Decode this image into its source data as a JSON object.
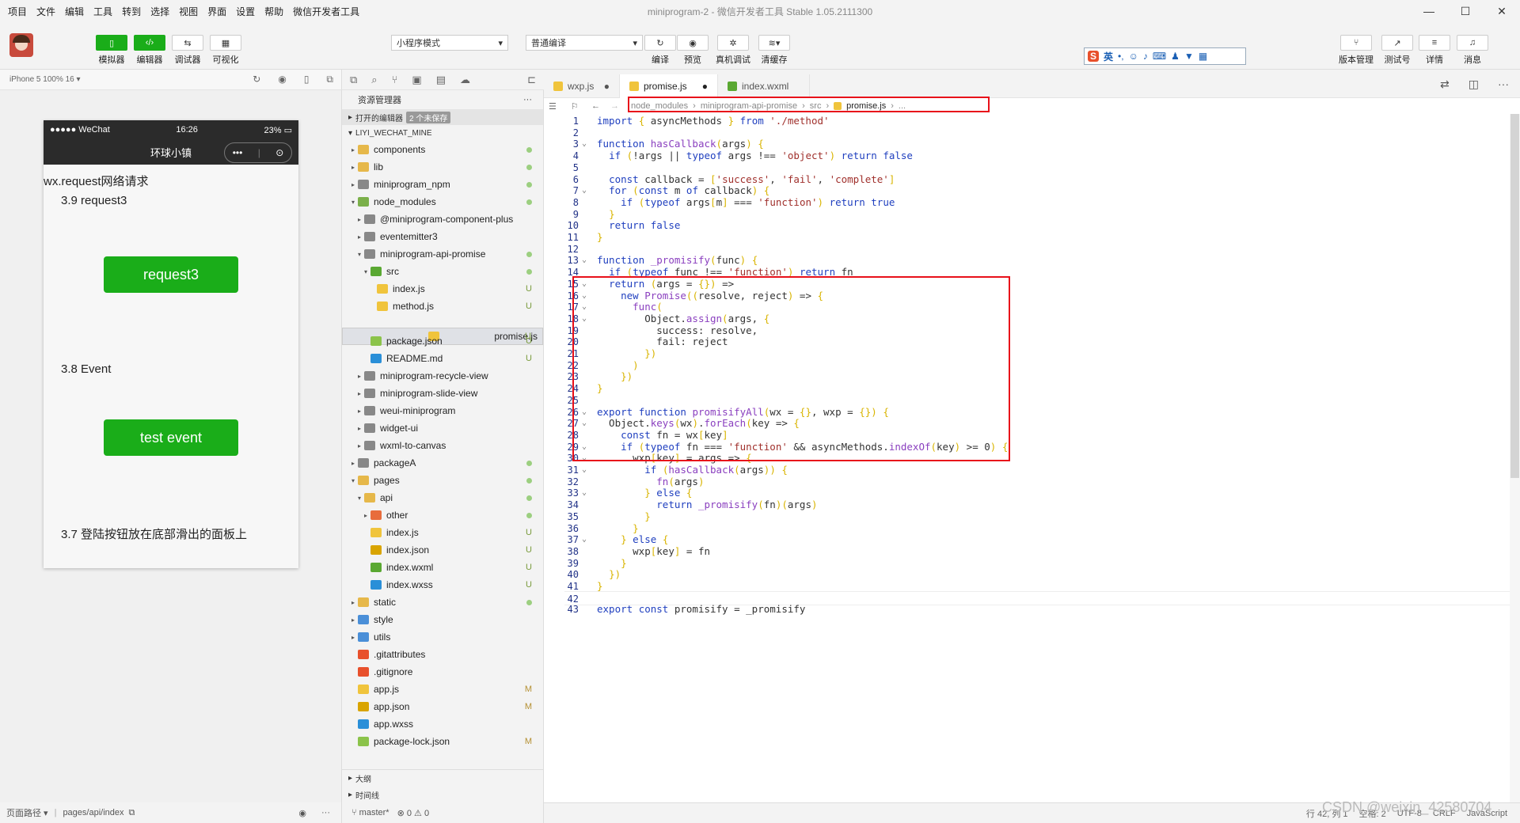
{
  "menubar": {
    "items": [
      "项目",
      "文件",
      "编辑",
      "工具",
      "转到",
      "选择",
      "视图",
      "界面",
      "设置",
      "帮助",
      "微信开发者工具"
    ],
    "title_project": "miniprogram-2",
    "title_rest": " - 微信开发者工具 Stable 1.05.2111300",
    "window_controls": [
      "—",
      "☐",
      "✕"
    ]
  },
  "toolbar": {
    "left": [
      {
        "icon": "phone-icon",
        "label": "模拟器"
      },
      {
        "icon": "code-icon",
        "label": "编辑器"
      },
      {
        "icon": "debug-icon",
        "label": "调试器"
      },
      {
        "icon": "layout-icon",
        "label": "可视化"
      }
    ],
    "mode_select": "小程序模式",
    "compile_select": "普通编译",
    "actions": [
      {
        "icon": "refresh-icon",
        "label": "编译"
      },
      {
        "icon": "eye-icon",
        "label": "预览"
      },
      {
        "icon": "bug-icon",
        "label": "真机调试"
      },
      {
        "icon": "layers-icon",
        "label": "清缓存"
      }
    ],
    "right": [
      {
        "icon": "branch-icon",
        "label": "版本管理"
      },
      {
        "icon": "external-icon",
        "label": "测试号"
      },
      {
        "icon": "menu-icon",
        "label": "详情"
      },
      {
        "icon": "bell-icon",
        "label": "消息"
      }
    ],
    "ime_text": "英"
  },
  "simulator": {
    "device": "iPhone 5 100% 16 ▾",
    "status_left": "●●●●● WeChat",
    "status_time": "16:26",
    "status_battery": "23%",
    "nav_title": "环球小镇",
    "capsule_more": "•••",
    "capsule_close": "⊙",
    "heading": "wx.request网络请求",
    "section1": "3.9 request3",
    "button1": "request3",
    "section2": "3.8 Event",
    "button2": "test event",
    "section3": "3.7 登陆按钮放在底部滑出的面板上",
    "footer_path_label": "页面路径 ▾",
    "footer_path": "pages/api/index"
  },
  "explorer": {
    "title": "资源管理器",
    "more": "···",
    "open_editors": "打开的编辑器",
    "unsaved": "2 个未保存",
    "root": "LIYI_WECHAT_MINE",
    "rows": [
      {
        "label": "components",
        "indent": 1,
        "tw": "▸",
        "color": "#e6b84a",
        "st": "dot"
      },
      {
        "label": "lib",
        "indent": 1,
        "tw": "▸",
        "color": "#e6b84a",
        "st": "dot"
      },
      {
        "label": "miniprogram_npm",
        "indent": 1,
        "tw": "▸",
        "color": "#888",
        "st": "dot"
      },
      {
        "label": "node_modules",
        "indent": 1,
        "tw": "▾",
        "color": "#7bb04a",
        "st": "dot"
      },
      {
        "label": "@miniprogram-component-plus",
        "indent": 2,
        "tw": "▸",
        "color": "#888",
        "st": ""
      },
      {
        "label": "eventemitter3",
        "indent": 2,
        "tw": "▸",
        "color": "#888",
        "st": ""
      },
      {
        "label": "miniprogram-api-promise",
        "indent": 2,
        "tw": "▾",
        "color": "#888",
        "st": "dot"
      },
      {
        "label": "src",
        "indent": 3,
        "tw": "▾",
        "color": "#5aa832",
        "st": "dot"
      },
      {
        "label": "index.js",
        "indent": 4,
        "tw": "",
        "color": "#f0c43c",
        "st": "U"
      },
      {
        "label": "method.js",
        "indent": 4,
        "tw": "",
        "color": "#f0c43c",
        "st": "U"
      },
      {
        "label": "promise.js",
        "indent": 4,
        "tw": "",
        "color": "#f0c43c",
        "st": "U",
        "selected": true
      },
      {
        "label": "package.json",
        "indent": 3,
        "tw": "",
        "color": "#8bc34a",
        "st": "U"
      },
      {
        "label": "README.md",
        "indent": 3,
        "tw": "",
        "color": "#2a8fd8",
        "st": "U"
      },
      {
        "label": "miniprogram-recycle-view",
        "indent": 2,
        "tw": "▸",
        "color": "#888",
        "st": ""
      },
      {
        "label": "miniprogram-slide-view",
        "indent": 2,
        "tw": "▸",
        "color": "#888",
        "st": ""
      },
      {
        "label": "weui-miniprogram",
        "indent": 2,
        "tw": "▸",
        "color": "#888",
        "st": ""
      },
      {
        "label": "widget-ui",
        "indent": 2,
        "tw": "▸",
        "color": "#888",
        "st": ""
      },
      {
        "label": "wxml-to-canvas",
        "indent": 2,
        "tw": "▸",
        "color": "#888",
        "st": ""
      },
      {
        "label": "packageA",
        "indent": 1,
        "tw": "▸",
        "color": "#888",
        "st": "dot"
      },
      {
        "label": "pages",
        "indent": 1,
        "tw": "▾",
        "color": "#e6b84a",
        "st": "dot"
      },
      {
        "label": "api",
        "indent": 2,
        "tw": "▾",
        "color": "#e6b84a",
        "st": "dot"
      },
      {
        "label": "other",
        "indent": 3,
        "tw": "▸",
        "color": "#e86c3c",
        "st": "dot"
      },
      {
        "label": "index.js",
        "indent": 3,
        "tw": "",
        "color": "#f0c43c",
        "st": "U"
      },
      {
        "label": "index.json",
        "indent": 3,
        "tw": "",
        "color": "#d9a400",
        "st": "U"
      },
      {
        "label": "index.wxml",
        "indent": 3,
        "tw": "",
        "color": "#5aa832",
        "st": "U"
      },
      {
        "label": "index.wxss",
        "indent": 3,
        "tw": "",
        "color": "#2a8fd8",
        "st": "U"
      },
      {
        "label": "static",
        "indent": 1,
        "tw": "▸",
        "color": "#e6b84a",
        "st": "dot"
      },
      {
        "label": "style",
        "indent": 1,
        "tw": "▸",
        "color": "#4a8fd8",
        "st": ""
      },
      {
        "label": "utils",
        "indent": 1,
        "tw": "▸",
        "color": "#4a8fd8",
        "st": ""
      },
      {
        "label": ".gitattributes",
        "indent": 1,
        "tw": "",
        "color": "#e8502c",
        "st": ""
      },
      {
        "label": ".gitignore",
        "indent": 1,
        "tw": "",
        "color": "#e8502c",
        "st": ""
      },
      {
        "label": "app.js",
        "indent": 1,
        "tw": "",
        "color": "#f0c43c",
        "st": "M"
      },
      {
        "label": "app.json",
        "indent": 1,
        "tw": "",
        "color": "#d9a400",
        "st": "M"
      },
      {
        "label": "app.wxss",
        "indent": 1,
        "tw": "",
        "color": "#2a8fd8",
        "st": ""
      },
      {
        "label": "package-lock.json",
        "indent": 1,
        "tw": "",
        "color": "#8bc34a",
        "st": "M"
      }
    ],
    "outline": "大纲",
    "timeline": "时间线",
    "branch": "master*",
    "problems": "⊗ 0 ⚠ 0"
  },
  "tabs": [
    {
      "label": "wxp.js",
      "icon": "js",
      "modified": true,
      "active": false
    },
    {
      "label": "promise.js",
      "icon": "js",
      "modified": true,
      "active": true
    },
    {
      "label": "index.wxml",
      "icon": "wxml",
      "modified": false,
      "active": false
    }
  ],
  "breadcrumb": [
    "node_modules",
    "miniprogram-api-promise",
    "src",
    "promise.js",
    "..."
  ],
  "code_lines": [
    "import { asyncMethods } from './method'",
    "",
    "function hasCallback(args) {",
    "  if (!args || typeof args !== 'object') return false",
    "",
    "  const callback = ['success', 'fail', 'complete']",
    "  for (const m of callback) {",
    "    if (typeof args[m] === 'function') return true",
    "  }",
    "  return false",
    "}",
    "",
    "function _promisify(func) {",
    "  if (typeof func !== 'function') return fn",
    "  return (args = {}) =>",
    "    new Promise((resolve, reject) => {",
    "      func(",
    "        Object.assign(args, {",
    "          success: resolve,",
    "          fail: reject",
    "        })",
    "      )",
    "    })",
    "}",
    "",
    "export function promisifyAll(wx = {}, wxp = {}) {",
    "  Object.keys(wx).forEach(key => {",
    "    const fn = wx[key]",
    "    if (typeof fn === 'function' && asyncMethods.indexOf(key) >= 0) {",
    "      wxp[key] = args => {",
    "        if (hasCallback(args)) {",
    "          fn(args)",
    "        } else {",
    "          return _promisify(fn)(args)",
    "        }",
    "      }",
    "    } else {",
    "      wxp[key] = fn",
    "    }",
    "  })",
    "}",
    "",
    "export const promisify = _promisify"
  ],
  "fold_lines": [
    3,
    7,
    13,
    15,
    16,
    17,
    18,
    26,
    27,
    29,
    30,
    31,
    33,
    37
  ],
  "current_line": 42,
  "status": {
    "position": "行 42, 列 1",
    "spaces": "空格: 2",
    "encoding": "UTF-8",
    "eol": "CRLF",
    "language": "JavaScript"
  },
  "watermark": "CSDN @weixin_42580704"
}
